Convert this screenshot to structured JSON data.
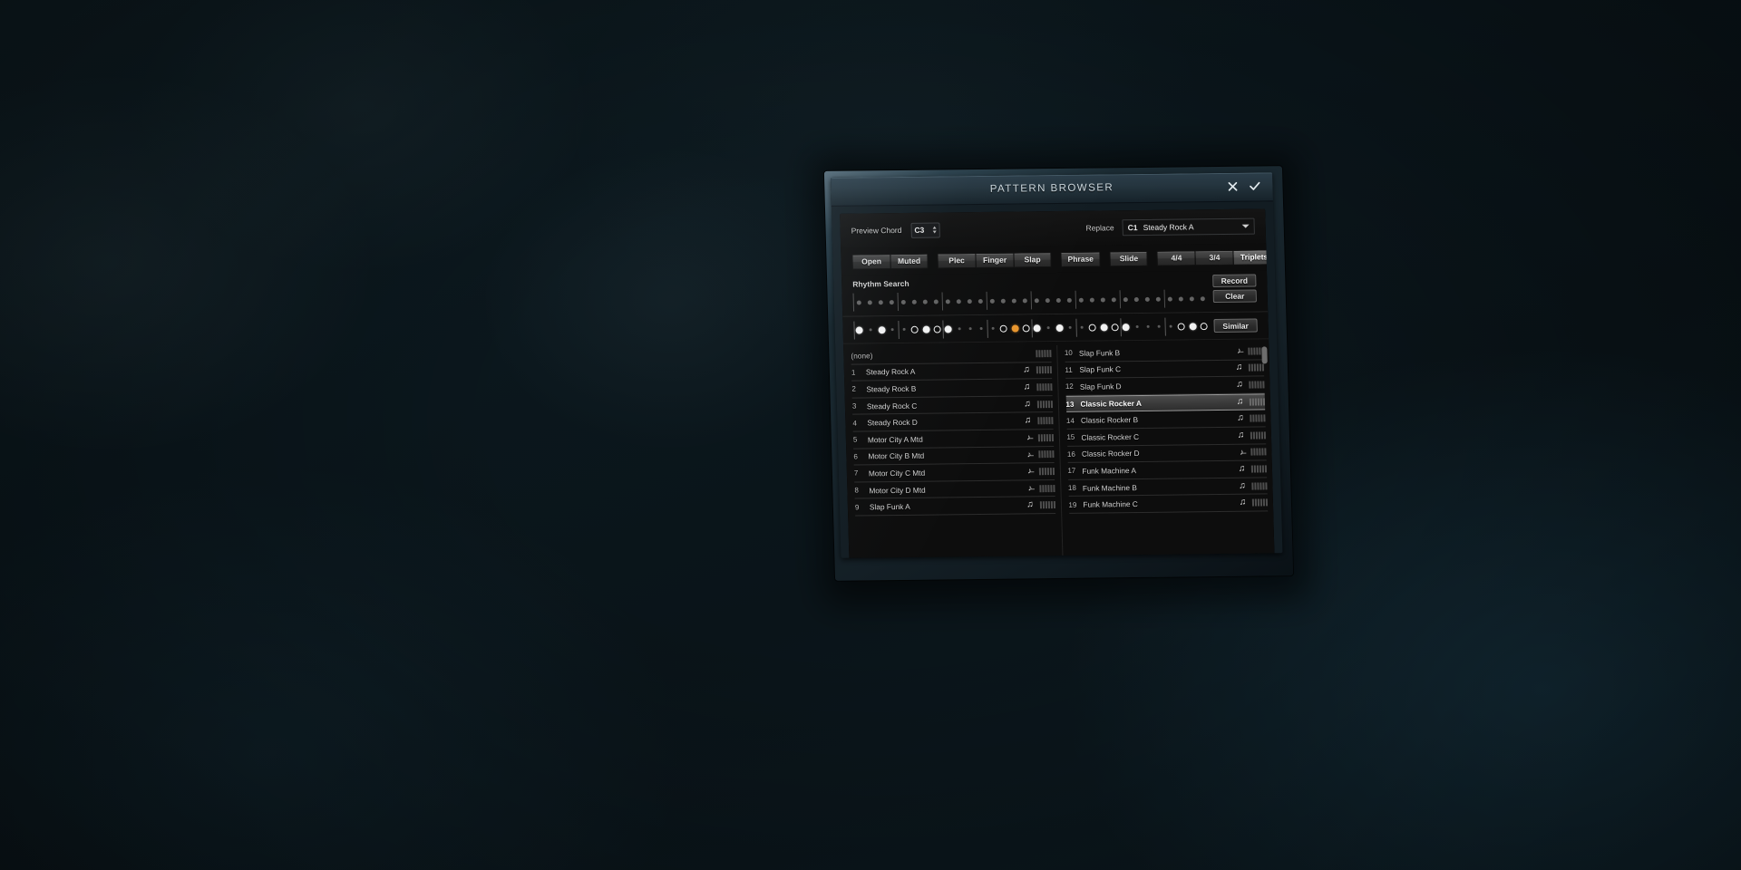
{
  "window": {
    "title": "PATTERN BROWSER",
    "close_icon": "close-icon",
    "confirm_icon": "check-icon"
  },
  "toolbar": {
    "preview_chord_label": "Preview Chord",
    "preview_chord_value": "C3",
    "replace_label": "Replace",
    "replace_slot": "C1",
    "replace_value": "Steady Rock A",
    "dropdown_icon": "chevron-down-icon"
  },
  "filters": [
    {
      "group": "articulation",
      "buttons": [
        {
          "label": "Open",
          "active": false
        },
        {
          "label": "Muted",
          "active": false
        }
      ]
    },
    {
      "group": "technique",
      "buttons": [
        {
          "label": "Plec",
          "active": false
        },
        {
          "label": "Finger",
          "active": false
        },
        {
          "label": "Slap",
          "active": false
        }
      ]
    },
    {
      "group": "phrase",
      "buttons": [
        {
          "label": "Phrase",
          "active": false
        }
      ]
    },
    {
      "group": "slide",
      "buttons": [
        {
          "label": "Slide",
          "active": false
        }
      ]
    },
    {
      "group": "meter",
      "buttons": [
        {
          "label": "4/4",
          "active": false
        },
        {
          "label": "3/4",
          "active": false
        },
        {
          "label": "Triplets",
          "active": true
        }
      ]
    }
  ],
  "rhythm_search": {
    "label": "Rhythm Search",
    "record_label": "Record",
    "clear_label": "Clear",
    "steps": 32,
    "bars_every": 4
  },
  "pattern_preview": {
    "similar_label": "Similar",
    "steps": [
      {
        "t": "full"
      },
      {
        "t": "tiny"
      },
      {
        "t": "full"
      },
      {
        "t": "tiny"
      },
      {
        "t": "tiny"
      },
      {
        "t": "ring"
      },
      {
        "t": "full"
      },
      {
        "t": "ring"
      },
      {
        "t": "full"
      },
      {
        "t": "tiny"
      },
      {
        "t": "tiny"
      },
      {
        "t": "tiny"
      },
      {
        "t": "tiny"
      },
      {
        "t": "ring"
      },
      {
        "t": "accent"
      },
      {
        "t": "ring"
      },
      {
        "t": "full"
      },
      {
        "t": "tiny"
      },
      {
        "t": "full"
      },
      {
        "t": "tiny"
      },
      {
        "t": "tiny"
      },
      {
        "t": "ring"
      },
      {
        "t": "full"
      },
      {
        "t": "ring"
      },
      {
        "t": "full"
      },
      {
        "t": "tiny"
      },
      {
        "t": "tiny"
      },
      {
        "t": "tiny"
      },
      {
        "t": "tiny"
      },
      {
        "t": "ring"
      },
      {
        "t": "full"
      },
      {
        "t": "ring"
      }
    ],
    "colors": {
      "accent": "#e8962e",
      "on": "#f2f2f2",
      "off": "#5c5c5c"
    }
  },
  "list_left": [
    {
      "num": "",
      "name": "(none)",
      "note": "",
      "selected": false
    },
    {
      "num": "1",
      "name": "Steady Rock A",
      "note": "note",
      "selected": false
    },
    {
      "num": "2",
      "name": "Steady Rock B",
      "note": "note",
      "selected": false
    },
    {
      "num": "3",
      "name": "Steady Rock C",
      "note": "note",
      "selected": false
    },
    {
      "num": "4",
      "name": "Steady Rock D",
      "note": "note",
      "selected": false
    },
    {
      "num": "5",
      "name": "Motor City A Mtd",
      "note": "swing",
      "selected": false
    },
    {
      "num": "6",
      "name": "Motor City B Mtd",
      "note": "swing",
      "selected": false
    },
    {
      "num": "7",
      "name": "Motor City C Mtd",
      "note": "swing",
      "selected": false
    },
    {
      "num": "8",
      "name": "Motor City D Mtd",
      "note": "swing",
      "selected": false
    },
    {
      "num": "9",
      "name": "Slap Funk A",
      "note": "note",
      "selected": false
    }
  ],
  "list_right": [
    {
      "num": "10",
      "name": "Slap Funk B",
      "note": "swing",
      "selected": false
    },
    {
      "num": "11",
      "name": "Slap Funk C",
      "note": "note",
      "selected": false
    },
    {
      "num": "12",
      "name": "Slap Funk D",
      "note": "note",
      "selected": false
    },
    {
      "num": "13",
      "name": "Classic Rocker A",
      "note": "note",
      "selected": true
    },
    {
      "num": "14",
      "name": "Classic Rocker B",
      "note": "note",
      "selected": false
    },
    {
      "num": "15",
      "name": "Classic Rocker C",
      "note": "note",
      "selected": false
    },
    {
      "num": "16",
      "name": "Classic Rocker D",
      "note": "swing",
      "selected": false
    },
    {
      "num": "17",
      "name": "Funk Machine A",
      "note": "note",
      "selected": false
    },
    {
      "num": "18",
      "name": "Funk Machine B",
      "note": "note",
      "selected": false
    },
    {
      "num": "19",
      "name": "Funk Machine C",
      "note": "note",
      "selected": false
    }
  ],
  "icons": {
    "note": "♫",
    "swing": "♪̶"
  }
}
